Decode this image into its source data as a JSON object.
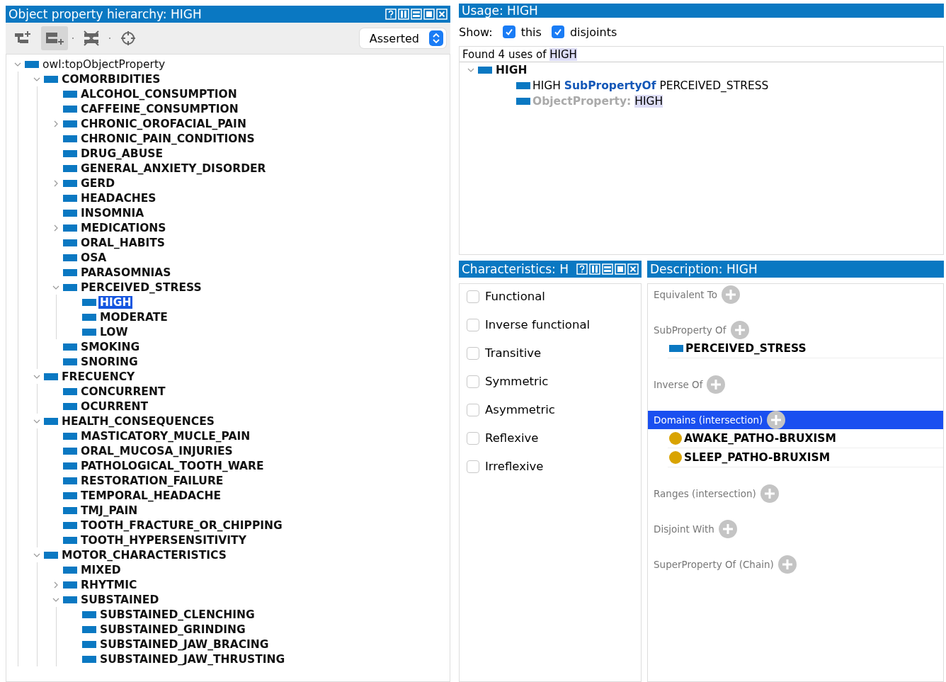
{
  "hierarchy": {
    "title": "Object property hierarchy: HIGH",
    "toolbar": [
      {
        "kind": "add-sub",
        "pressed": false
      },
      {
        "kind": "add-sibling",
        "pressed": true
      },
      {
        "kind": "delete",
        "pressed": false
      },
      {
        "kind": "target",
        "pressed": false
      }
    ],
    "mode": "Asserted",
    "tree": [
      {
        "label": "owl:topObjectProperty",
        "selected": false,
        "expanded": true,
        "children": [
          {
            "label": "COMORBIDITIES",
            "selected": false,
            "expanded": true,
            "children": [
              {
                "label": "ALCOHOL_CONSUMPTION",
                "selected": false
              },
              {
                "label": "CAFFEINE_CONSUMPTION",
                "selected": false
              },
              {
                "label": "CHRONIC_OROFACIAL_PAIN",
                "selected": false,
                "expanded": false
              },
              {
                "label": "CHRONIC_PAIN_CONDITIONS",
                "selected": false
              },
              {
                "label": "DRUG_ABUSE",
                "selected": false
              },
              {
                "label": "GENERAL_ANXIETY_DISORDER",
                "selected": false
              },
              {
                "label": "GERD",
                "selected": false,
                "expanded": false
              },
              {
                "label": "HEADACHES",
                "selected": false
              },
              {
                "label": "INSOMNIA",
                "selected": false
              },
              {
                "label": "MEDICATIONS",
                "selected": false,
                "expanded": false
              },
              {
                "label": "ORAL_HABITS",
                "selected": false
              },
              {
                "label": "OSA",
                "selected": false
              },
              {
                "label": "PARASOMNIAS",
                "selected": false
              },
              {
                "label": "PERCEIVED_STRESS",
                "selected": false,
                "expanded": true,
                "children": [
                  {
                    "label": "HIGH",
                    "selected": true
                  },
                  {
                    "label": "MODERATE",
                    "selected": false
                  },
                  {
                    "label": "LOW",
                    "selected": false
                  }
                ]
              },
              {
                "label": "SMOKING",
                "selected": false
              },
              {
                "label": "SNORING",
                "selected": false
              }
            ]
          },
          {
            "label": "FRECUENCY",
            "selected": false,
            "expanded": true,
            "children": [
              {
                "label": "CONCURRENT",
                "selected": false
              },
              {
                "label": "OCURRENT",
                "selected": false
              }
            ]
          },
          {
            "label": "HEALTH_CONSEQUENCES",
            "selected": false,
            "expanded": true,
            "children": [
              {
                "label": "MASTICATORY_MUCLE_PAIN",
                "selected": false
              },
              {
                "label": "ORAL_MUCOSA_INJURIES",
                "selected": false
              },
              {
                "label": "PATHOLOGICAL_TOOTH_WARE",
                "selected": false
              },
              {
                "label": "RESTORATION_FAILURE",
                "selected": false
              },
              {
                "label": "TEMPORAL_HEADACHE",
                "selected": false
              },
              {
                "label": "TMJ_PAIN",
                "selected": false
              },
              {
                "label": "TOOTH_FRACTURE_OR_CHIPPING",
                "selected": false
              },
              {
                "label": "TOOTH_HYPERSENSITIVITY",
                "selected": false
              }
            ]
          },
          {
            "label": "MOTOR_CHARACTERISTICS",
            "selected": false,
            "expanded": true,
            "children": [
              {
                "label": "MIXED",
                "selected": false
              },
              {
                "label": "RHYTMIC",
                "selected": false,
                "expanded": false
              },
              {
                "label": "SUBSTAINED",
                "selected": false,
                "expanded": true,
                "children": [
                  {
                    "label": "SUBSTAINED_CLENCHING",
                    "selected": false
                  },
                  {
                    "label": "SUBSTAINED_GRINDING",
                    "selected": false
                  },
                  {
                    "label": "SUBSTAINED_JAW_BRACING",
                    "selected": false
                  },
                  {
                    "label": "SUBSTAINED_JAW_THRUSTING",
                    "selected": false
                  }
                ]
              }
            ]
          }
        ]
      }
    ]
  },
  "usage": {
    "title": "Usage: HIGH",
    "show_label": "Show:",
    "filters": [
      {
        "label": "this",
        "checked": true
      },
      {
        "label": "disjoints",
        "checked": true
      }
    ],
    "found": {
      "prefix": "Found 4 uses of",
      "term": "HIGH"
    },
    "subject": {
      "label": "HIGH",
      "expanded": true
    },
    "rows": [
      [
        {
          "kind": "plain",
          "text": "HIGH"
        },
        {
          "kind": "keyword",
          "text": "SubPropertyOf"
        },
        {
          "kind": "plain",
          "text": "PERCEIVED_STRESS"
        }
      ],
      [
        {
          "kind": "muted",
          "text": "ObjectProperty:"
        },
        {
          "kind": "highlight",
          "text": "HIGH"
        }
      ]
    ]
  },
  "characteristics": {
    "title": "Characteristics: H",
    "items": [
      {
        "label": "Functional",
        "checked": false
      },
      {
        "label": "Inverse functional",
        "checked": false
      },
      {
        "label": "Transitive",
        "checked": false
      },
      {
        "label": "Symmetric",
        "checked": false
      },
      {
        "label": "Asymmetric",
        "checked": false
      },
      {
        "label": "Reflexive",
        "checked": false
      },
      {
        "label": "Irreflexive",
        "checked": false
      }
    ]
  },
  "description": {
    "title": "Description: HIGH",
    "sections": [
      {
        "label": "Equivalent To",
        "selected": false
      },
      {
        "label": "SubProperty Of",
        "selected": false,
        "items": [
          {
            "kind": "property",
            "label": "PERCEIVED_STRESS"
          }
        ]
      },
      {
        "label": "Inverse Of",
        "selected": false
      },
      {
        "label": "Domains (intersection)",
        "selected": true,
        "items": [
          {
            "kind": "class",
            "label": "AWAKE_PATHO-BRUXISM"
          },
          {
            "kind": "class",
            "label": "SLEEP_PATHO-BRUXISM"
          }
        ]
      },
      {
        "label": "Ranges (intersection)",
        "selected": false
      },
      {
        "label": "Disjoint With",
        "selected": false
      },
      {
        "label": "SuperProperty Of (Chain)",
        "selected": false
      }
    ]
  }
}
